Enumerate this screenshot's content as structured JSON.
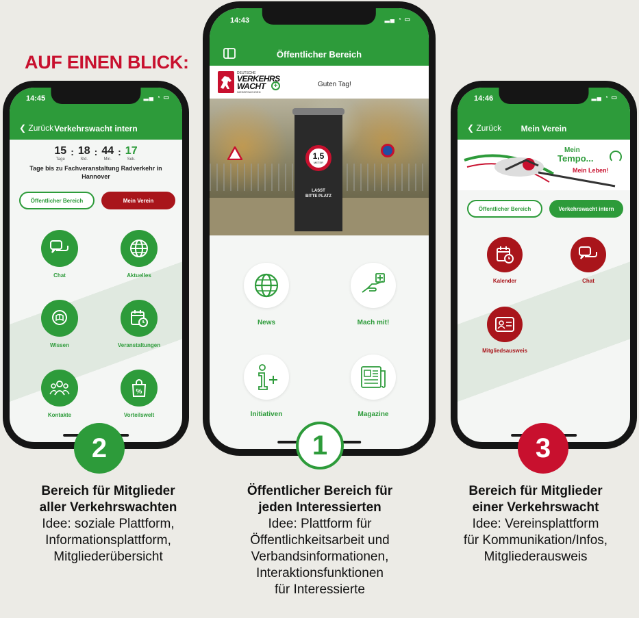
{
  "headline": "AUF EINEN BLICK:",
  "colors": {
    "green": "#2d9b3a",
    "red": "#a9151b"
  },
  "phone2": {
    "time": "14:45",
    "back": "Zurück",
    "title": "Verkehrswacht intern",
    "countdown": {
      "days": "15",
      "days_label": "Tage",
      "hours": "18",
      "hours_label": "Std.",
      "minutes": "44",
      "minutes_label": "Min.",
      "seconds": "17",
      "seconds_label": "Sek.",
      "text_line1": "Tage bis zu Fachveranstaltung Radverkehr in",
      "text_line2": "Hannover"
    },
    "btn_public": "Öffentlicher Bereich",
    "btn_club": "Mein Verein",
    "tiles": [
      "Chat",
      "Aktuelles",
      "Wissen",
      "Veranstaltungen",
      "Kontakte",
      "Vorteilswelt"
    ]
  },
  "phone1": {
    "time": "14:43",
    "title": "Öffentlicher Bereich",
    "logo_small": "DEUTSCHE",
    "logo_line1": "VERKEHRS",
    "logo_line2": "WACHT",
    "logo_sub": "NIEDERSACHSEN",
    "greeting": "Guten Tag!",
    "photo_sign_num": "1,5",
    "photo_sign_unit": "METER",
    "photo_column_text1": "LASST",
    "photo_column_text2": "BITTE PLATZ",
    "tiles": [
      "News",
      "Mach mit!",
      "Initiativen",
      "Magazine"
    ]
  },
  "phone3": {
    "time": "14:46",
    "back": "Zurück",
    "title": "Mein Verein",
    "banner_line1": "Mein",
    "banner_line2": "Tempo...",
    "banner_line3": "Mein Leben!",
    "btn_public": "Öffentlicher Bereich",
    "btn_internal": "Verkehrswacht intern",
    "tiles": [
      "Kalender",
      "Chat",
      "Mitgliedsausweis"
    ]
  },
  "badges": [
    "2",
    "1",
    "3"
  ],
  "captions": {
    "left": {
      "bold1": "Bereich für Mitglieder",
      "bold2": "aller Verkehrswachten",
      "line1": "Idee: soziale Plattform,",
      "line2": "Informationsplattform,",
      "line3": "Mitgliederübersicht"
    },
    "center": {
      "bold1": "Öffentlicher Bereich für",
      "bold2": "jeden Interessierten",
      "line1": "Idee: Plattform für",
      "line2": "Öffentlichkeitsarbeit und",
      "line3": "Verbandsinformationen,",
      "line4": "Interaktionsfunktionen",
      "line5": "für Interessierte"
    },
    "right": {
      "bold1": "Bereich für Mitglieder",
      "bold2": "einer Verkehrswacht",
      "line1": "Idee: Vereinsplattform",
      "line2": "für Kommunikation/Infos,",
      "line3": "Mitgliederausweis"
    }
  }
}
